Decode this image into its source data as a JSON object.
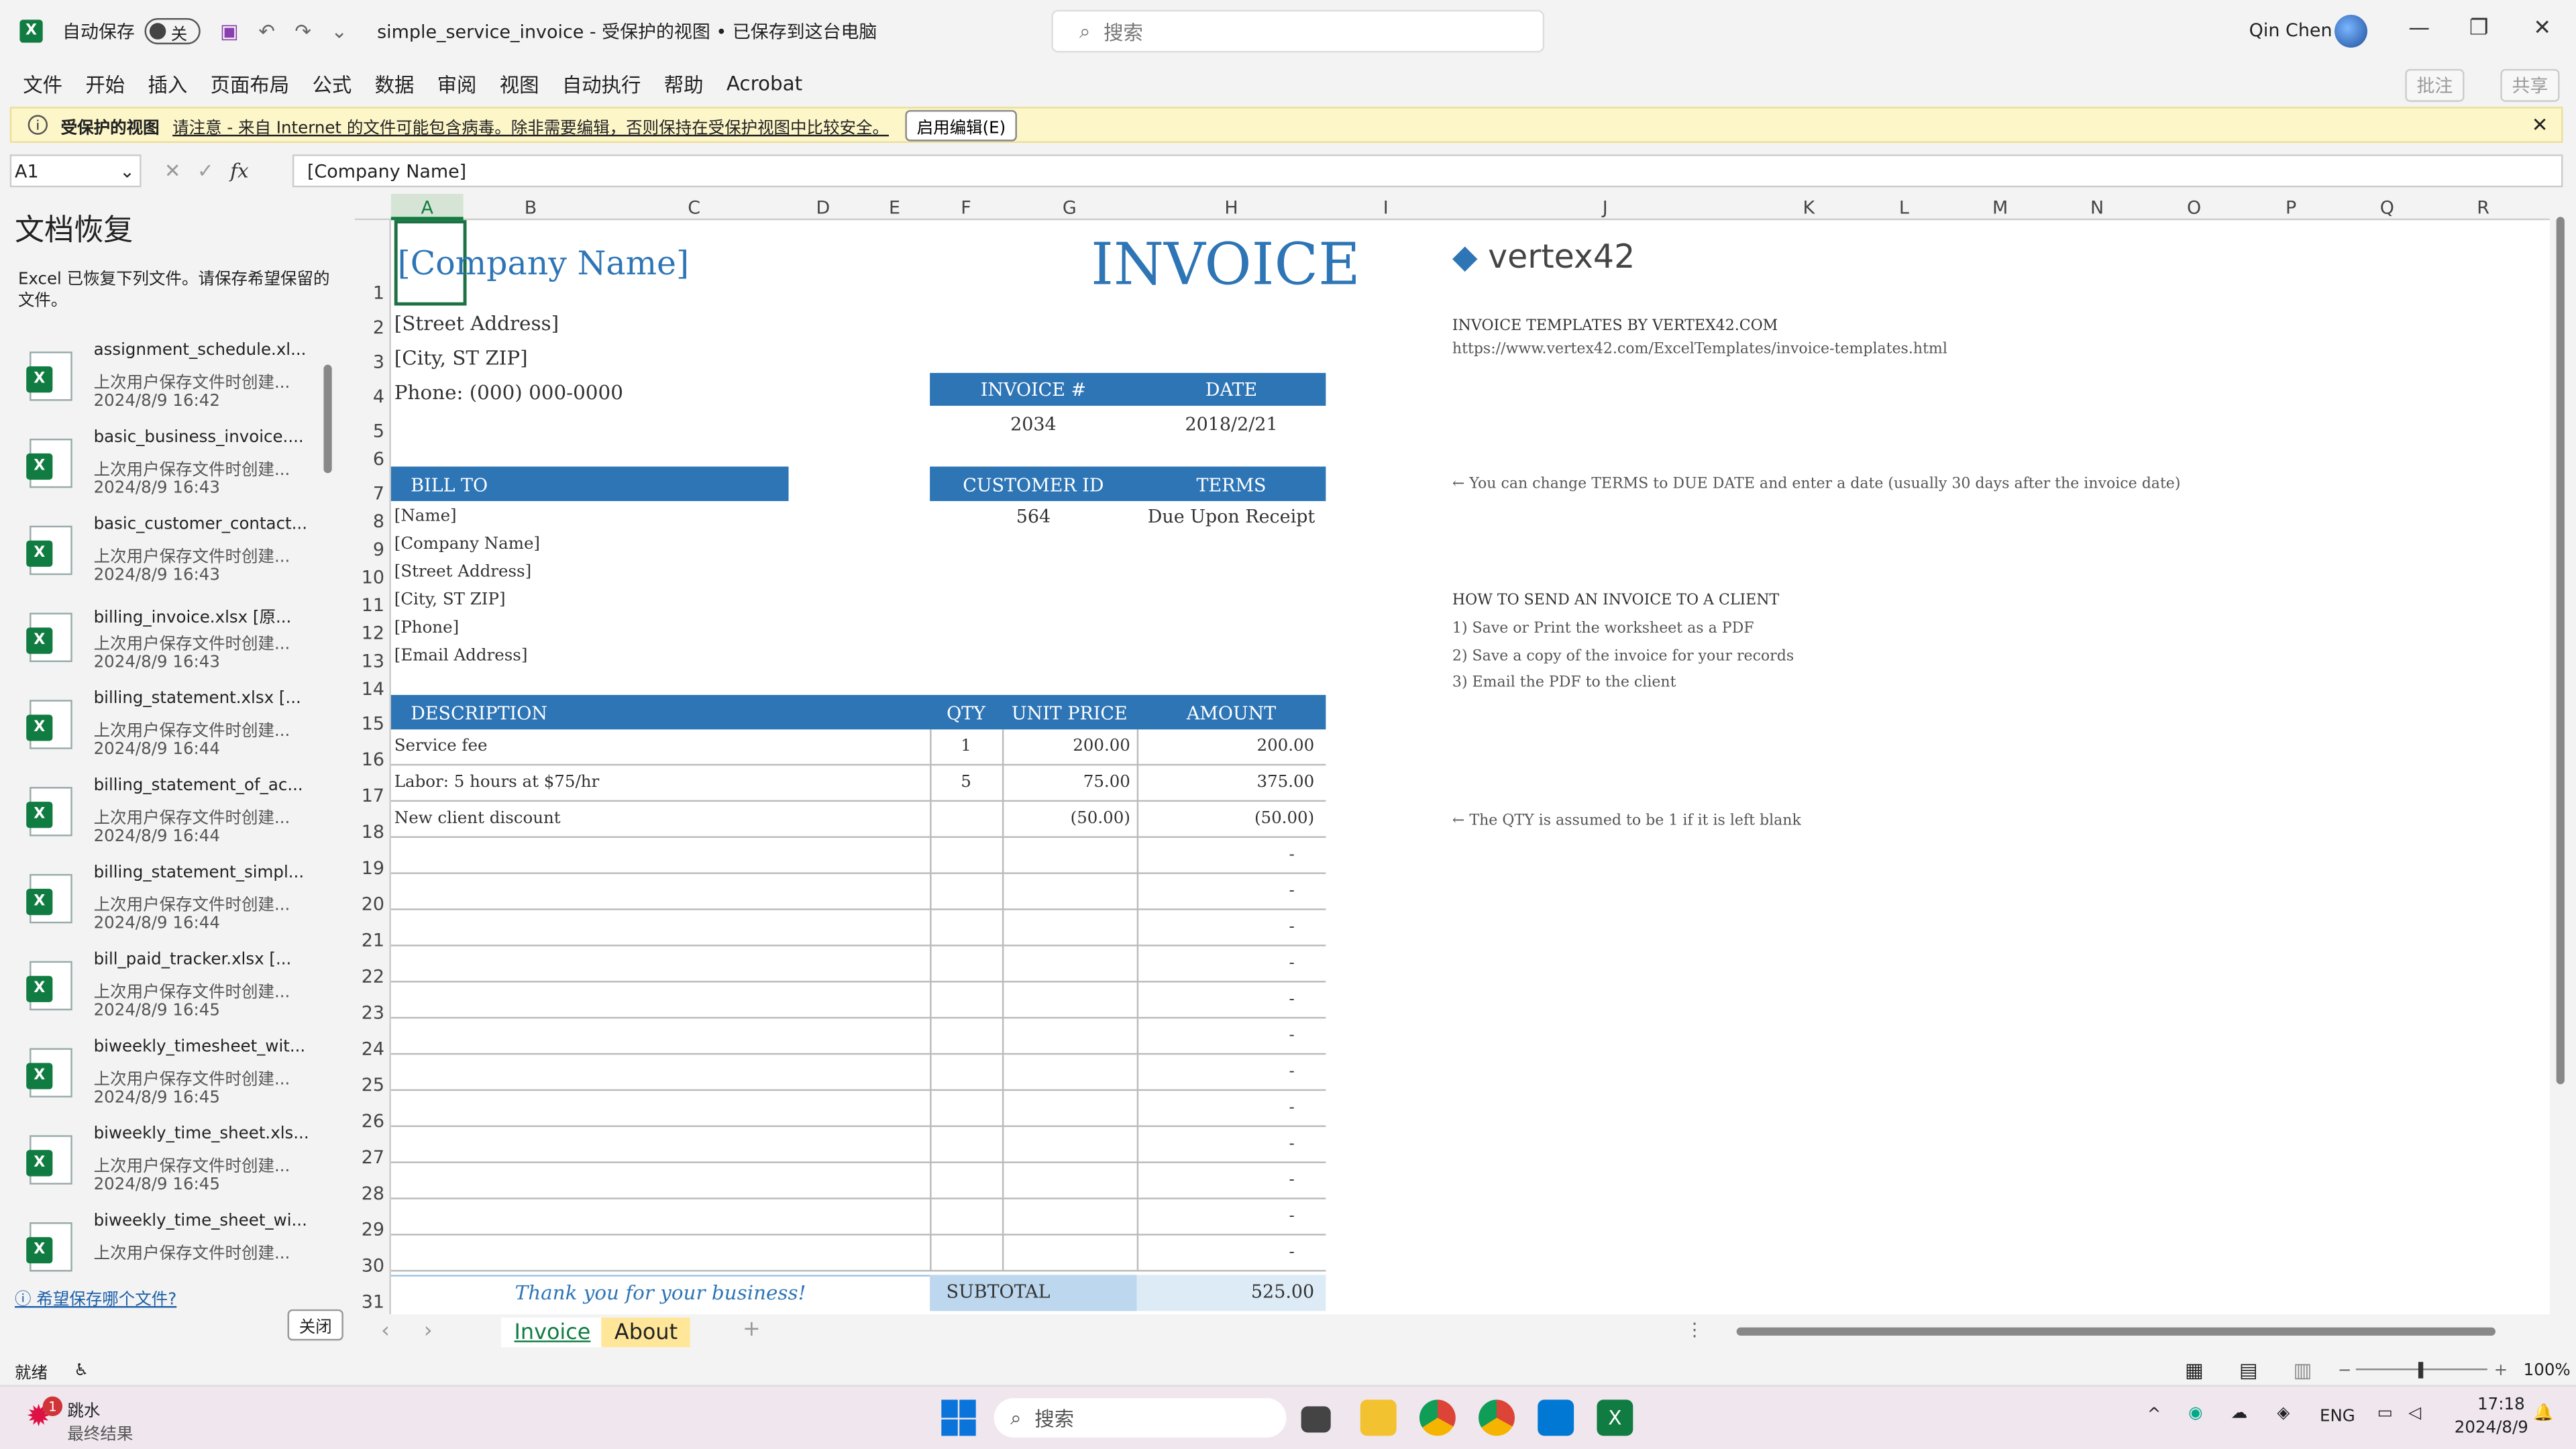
{
  "window": {
    "autosave_label": "自动保存",
    "autosave_state": "关",
    "doc_title": "simple_service_invoice  -  受保护的视图 • 已保存到这台电脑",
    "search_placeholder": "搜索",
    "user": "Qin Chen"
  },
  "menu": [
    "文件",
    "开始",
    "插入",
    "页面布局",
    "公式",
    "数据",
    "审阅",
    "视图",
    "自动执行",
    "帮助",
    "Acrobat"
  ],
  "menu_right": [
    "批注",
    "共享"
  ],
  "protected": {
    "title": "受保护的视图",
    "message": "请注意 - 来自 Internet 的文件可能包含病毒。除非需要编辑，否则保持在受保护视图中比较安全。",
    "button": "启用编辑(E)"
  },
  "formula": {
    "cell": "A1",
    "value": "[Company Name]"
  },
  "recovery": {
    "title": "文档恢复",
    "desc": "Excel 已恢复下列文件。请保存希望保留的文件。",
    "items": [
      {
        "name": "assignment_schedule.xl...",
        "sub": "上次用户保存文件时创建...",
        "date": "2024/8/9 16:42"
      },
      {
        "name": "basic_business_invoice....",
        "sub": "上次用户保存文件时创建...",
        "date": "2024/8/9 16:43"
      },
      {
        "name": "basic_customer_contact...",
        "sub": "上次用户保存文件时创建...",
        "date": "2024/8/9 16:43"
      },
      {
        "name": "billing_invoice.xlsx  [原...",
        "sub": "上次用户保存文件时创建...",
        "date": "2024/8/9 16:43"
      },
      {
        "name": "billing_statement.xlsx  [...",
        "sub": "上次用户保存文件时创建...",
        "date": "2024/8/9 16:44"
      },
      {
        "name": "billing_statement_of_ac...",
        "sub": "上次用户保存文件时创建...",
        "date": "2024/8/9 16:44"
      },
      {
        "name": "billing_statement_simpl...",
        "sub": "上次用户保存文件时创建...",
        "date": "2024/8/9 16:44"
      },
      {
        "name": "bill_paid_tracker.xlsx  [...",
        "sub": "上次用户保存文件时创建...",
        "date": "2024/8/9 16:45"
      },
      {
        "name": "biweekly_timesheet_wit...",
        "sub": "上次用户保存文件时创建...",
        "date": "2024/8/9 16:45"
      },
      {
        "name": "biweekly_time_sheet.xls...",
        "sub": "上次用户保存文件时创建...",
        "date": "2024/8/9 16:45"
      },
      {
        "name": "biweekly_time_sheet_wi...",
        "sub": "上次用户保存文件时创建...",
        "date": ""
      }
    ],
    "footer_link": "希望保存哪个文件?",
    "close": "关闭"
  },
  "columns": [
    "A",
    "B",
    "C",
    "D",
    "E",
    "F",
    "G",
    "H",
    "I",
    "J",
    "K",
    "L",
    "M",
    "N",
    "O",
    "P",
    "Q",
    "R"
  ],
  "rows": [
    "1",
    "2",
    "3",
    "4",
    "5",
    "6",
    "7",
    "8",
    "9",
    "10",
    "11",
    "12",
    "13",
    "14",
    "15",
    "16",
    "17",
    "18",
    "19",
    "20",
    "21",
    "22",
    "23",
    "24",
    "25",
    "26",
    "27",
    "28",
    "29",
    "30",
    "31"
  ],
  "invoice": {
    "company": "[Company Name]",
    "title": "INVOICE",
    "street": "[Street Address]",
    "city": "[City, ST  ZIP]",
    "phone": "Phone: (000) 000-0000",
    "inv_no_label": "INVOICE #",
    "date_label": "DATE",
    "inv_no": "2034",
    "date": "2018/2/21",
    "bill_to_label": "BILL TO",
    "cust_id_label": "CUSTOMER ID",
    "terms_label": "TERMS",
    "cust_id": "564",
    "terms": "Due Upon Receipt",
    "bill": [
      "[Name]",
      "[Company Name]",
      "[Street Address]",
      "[City, ST  ZIP]",
      "[Phone]",
      "[Email Address]"
    ],
    "hdr": {
      "desc": "DESCRIPTION",
      "qty": "QTY",
      "price": "UNIT PRICE",
      "amount": "AMOUNT"
    },
    "lines": [
      {
        "desc": "Service fee",
        "qty": "1",
        "price": "200.00",
        "amount": "200.00"
      },
      {
        "desc": "Labor: 5 hours at $75/hr",
        "qty": "5",
        "price": "75.00",
        "amount": "375.00"
      },
      {
        "desc": "New client discount",
        "qty": "",
        "price": "(50.00)",
        "amount": "(50.00)"
      }
    ],
    "empty_amount": "-",
    "thanks": "Thank you for your business!",
    "subtotal_label": "SUBTOTAL",
    "subtotal": "525.00"
  },
  "side": {
    "logo": "vertex42",
    "by": "INVOICE TEMPLATES BY VERTEX42.COM",
    "url": "https://www.vertex42.com/ExcelTemplates/invoice-templates.html",
    "note_terms": "← You can change TERMS to DUE DATE and enter a date (usually 30 days after the invoice date)",
    "how_title": "HOW TO SEND AN INVOICE TO A CLIENT",
    "how": [
      "1) Save or Print the worksheet as a PDF",
      "2) Save a copy of the invoice for your records",
      "3) Email the PDF to the client"
    ],
    "note_qty": "← The QTY is assumed to be 1 if it is left blank"
  },
  "tabs": [
    "Invoice",
    "About"
  ],
  "status": {
    "ready": "就绪",
    "zoom": "100%"
  },
  "taskbar": {
    "weather_title": "跳水",
    "weather_sub": "最终结果",
    "search": "搜索",
    "lang": "ENG",
    "time": "17:18",
    "date": "2024/8/9",
    "badge": "1"
  }
}
